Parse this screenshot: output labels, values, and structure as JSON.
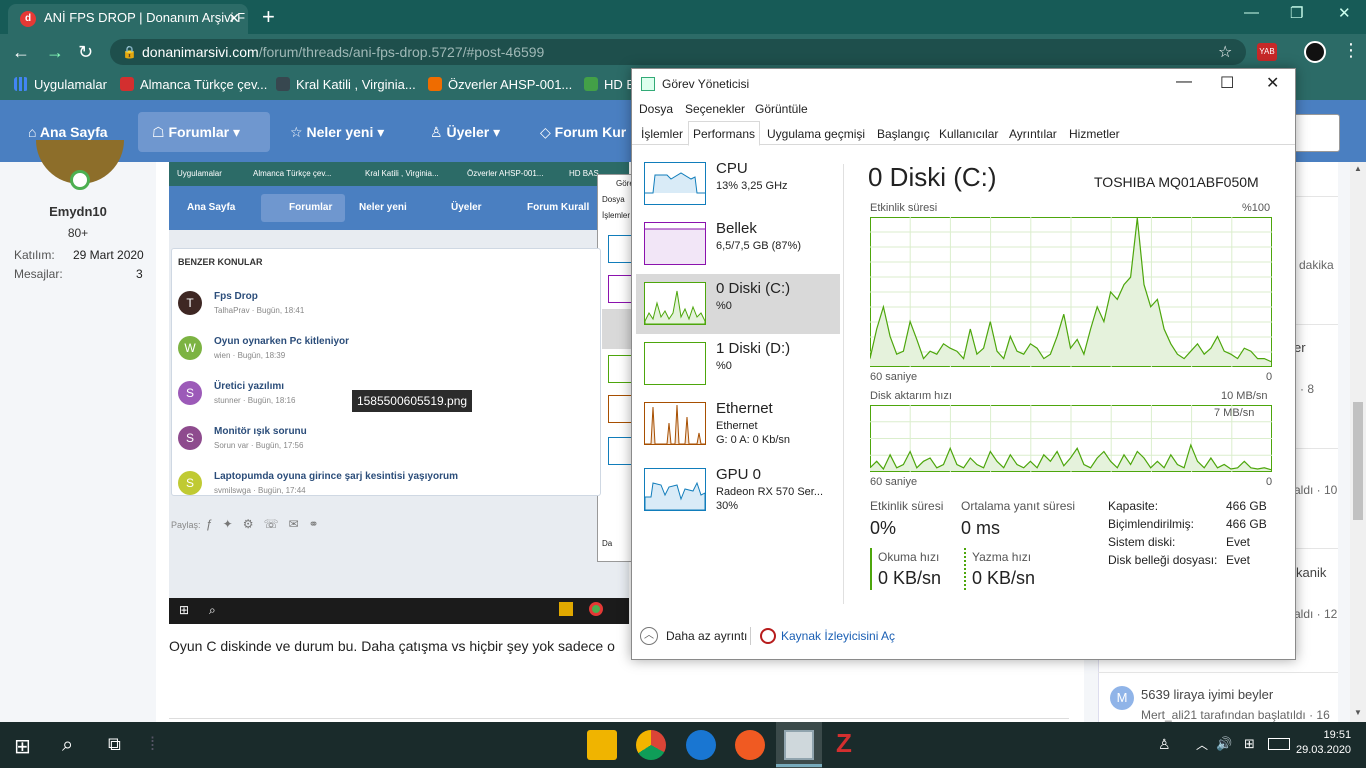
{
  "browser": {
    "tab_title": "ANİ FPS DROP | Donanım Arşivi F",
    "url_host": "donanimarsivi.com",
    "url_path": "/forum/threads/ani-fps-drop.5727/#post-46599",
    "ext_badge": "YAB",
    "bookmarks": [
      "Uygulamalar",
      "Almanca Türkçe çev...",
      "Kral Katili , Virginia...",
      "Özverler AHSP-001...",
      "HD B"
    ]
  },
  "site": {
    "nav": [
      "Ana Sayfa",
      "Forumlar",
      "Neler yeni",
      "Üyeler",
      "Forum Kur"
    ],
    "user": {
      "name": "Emydn10",
      "rank": "80+",
      "joined_label": "Katılım:",
      "joined_value": "29 Mart 2020",
      "messages_label": "Mesajlar:",
      "messages_value": "3"
    },
    "post_text": "Oyun C diskinde ve durum bu. Daha çatışma vs hiçbir şey yok sadece o",
    "right_fragments": [
      "dakika",
      "er",
      "· 8",
      "aldı · 10",
      "kanik",
      "aldı · 12"
    ],
    "right_thread": {
      "avatar_letter": "M",
      "title": "5639 liraya iyimi beyler",
      "meta": "Mert_ali21 tarafından başlatıldı · 16"
    }
  },
  "embedded": {
    "bookmarks": [
      "Uygulamalar",
      "Almanca Türkçe çev...",
      "Kral Katili , Virginia...",
      "Özverler AHSP-001...",
      "HD BAS"
    ],
    "nav": [
      "Ana Sayfa",
      "Forumlar",
      "Neler yeni",
      "Üyeler",
      "Forum Kurall"
    ],
    "tm_fragments": [
      "Göre",
      "Dosya",
      "İşlemler",
      "Da"
    ],
    "section_title": "BENZER KONULAR",
    "threads": [
      {
        "letter": "T",
        "title": "Fps Drop",
        "meta": "TalhaPrav · Bugün, 18:41",
        "color": "#3e2723"
      },
      {
        "letter": "W",
        "title": "Oyun oynarken Pc kitleniyor",
        "meta": "wien · Bugün, 18:39",
        "color": "#7cb342"
      },
      {
        "letter": "S",
        "title": "Üretici yazılımı",
        "meta": "stunner · Bugün, 18:16",
        "color": "#9c5ab8"
      },
      {
        "letter": "S",
        "title": "Monitör ışık sorunu",
        "meta": "Sorun var · Bugün, 17:56",
        "color": "#8e4b8e"
      },
      {
        "letter": "S",
        "title": "Laptopumda oyuna girince şarj kesintisi yaşıyorum",
        "meta": "svmilswga · Bugün, 17:44",
        "color": "#c0ca33"
      }
    ],
    "tooltip": "1585500605519.png",
    "share_label": "Paylaş:"
  },
  "taskmanager": {
    "title": "Görev Yöneticisi",
    "menu": [
      "Dosya",
      "Seçenekler",
      "Görüntüle"
    ],
    "tabs": [
      "İşlemler",
      "Performans",
      "Uygulama geçmişi",
      "Başlangıç",
      "Kullanıcılar",
      "Ayrıntılar",
      "Hizmetler"
    ],
    "active_tab": "Performans",
    "sidebar": [
      {
        "name": "CPU",
        "sub": "13%  3,25 GHz",
        "sub2": "",
        "color": "#117dbb"
      },
      {
        "name": "Bellek",
        "sub": "6,5/7,5 GB (87%)",
        "sub2": "",
        "color": "#8b12ae"
      },
      {
        "name": "0 Diski (C:)",
        "sub": "%0",
        "sub2": "",
        "color": "#4da60c"
      },
      {
        "name": "1 Diski (D:)",
        "sub": "%0",
        "sub2": "",
        "color": "#4da60c"
      },
      {
        "name": "Ethernet",
        "sub": "Ethernet",
        "sub2": "G: 0  A: 0 Kb/sn",
        "color": "#a74f01"
      },
      {
        "name": "GPU 0",
        "sub": "Radeon RX 570 Ser...",
        "sub2": "30%",
        "color": "#117dbb"
      }
    ],
    "disk": {
      "heading": "0 Diski (C:)",
      "model": "TOSHIBA MQ01ABF050M",
      "activity_label": "Etkinlik süresi",
      "activity_max": "%100",
      "activity_xleft": "60 saniye",
      "activity_xright": "0",
      "transfer_label": "Disk aktarım hızı",
      "transfer_max": "10 MB/sn",
      "transfer_mark": "7 MB/sn",
      "transfer_xleft": "60 saniye",
      "transfer_xright": "0",
      "stat_activity_label": "Etkinlik süresi",
      "stat_activity_value": "0%",
      "stat_response_label": "Ortalama yanıt süresi",
      "stat_response_value": "0 ms",
      "read_label": "Okuma hızı",
      "read_value": "0 KB/sn",
      "write_label": "Yazma hızı",
      "write_value": "0 KB/sn",
      "props": [
        {
          "k": "Kapasite:",
          "v": "466 GB"
        },
        {
          "k": "Biçimlendirilmiş:",
          "v": "466 GB"
        },
        {
          "k": "Sistem diski:",
          "v": "Evet"
        },
        {
          "k": "Disk belleği dosyası:",
          "v": "Evet"
        }
      ]
    },
    "footer_less": "Daha az ayrıntı",
    "footer_monitor": "Kaynak İzleyicisini Aç"
  },
  "chart_data": [
    {
      "type": "area",
      "title": "Etkinlik süresi",
      "ylim": [
        0,
        100
      ],
      "x": [
        60,
        59,
        58,
        57,
        56,
        55,
        54,
        53,
        52,
        51,
        50,
        49,
        48,
        47,
        46,
        45,
        44,
        43,
        42,
        41,
        40,
        39,
        38,
        37,
        36,
        35,
        34,
        33,
        32,
        31,
        30,
        29,
        28,
        27,
        26,
        25,
        24,
        23,
        22,
        21,
        20,
        19,
        18,
        17,
        16,
        15,
        14,
        13,
        12,
        11,
        10,
        9,
        8,
        7,
        6,
        5,
        4,
        3,
        2,
        1,
        0
      ],
      "values": [
        5,
        25,
        40,
        20,
        8,
        10,
        30,
        18,
        5,
        10,
        8,
        15,
        12,
        10,
        5,
        25,
        8,
        12,
        30,
        10,
        5,
        20,
        10,
        8,
        15,
        12,
        5,
        8,
        20,
        35,
        12,
        18,
        8,
        25,
        40,
        30,
        50,
        45,
        55,
        60,
        110,
        55,
        40,
        45,
        25,
        15,
        8,
        5,
        10,
        15,
        8,
        12,
        20,
        10,
        8,
        5,
        12,
        10,
        5,
        5,
        3
      ]
    },
    {
      "type": "area",
      "title": "Disk aktarım hızı",
      "ylim": [
        0,
        10
      ],
      "x": [
        60,
        59,
        58,
        57,
        56,
        55,
        54,
        53,
        52,
        51,
        50,
        49,
        48,
        47,
        46,
        45,
        44,
        43,
        42,
        41,
        40,
        39,
        38,
        37,
        36,
        35,
        34,
        33,
        32,
        31,
        30,
        29,
        28,
        27,
        26,
        25,
        24,
        23,
        22,
        21,
        20,
        19,
        18,
        17,
        16,
        15,
        14,
        13,
        12,
        11,
        10,
        9,
        8,
        7,
        6,
        5,
        4,
        3,
        2,
        1,
        0
      ],
      "values": [
        0.5,
        1.5,
        0.3,
        2.5,
        0.5,
        1.0,
        3.0,
        0.5,
        1.5,
        2.0,
        0.5,
        1.0,
        3.5,
        1.0,
        0.5,
        2.0,
        1.0,
        0.5,
        3.0,
        1.5,
        0.5,
        2.5,
        1.0,
        0.5,
        1.5,
        0.5,
        2.5,
        1.5,
        3.0,
        0.8,
        2.0,
        3.5,
        1.0,
        0.5,
        2.0,
        3.0,
        1.5,
        0.5,
        2.5,
        1.0,
        3.0,
        2.0,
        0.5,
        1.5,
        0.5,
        2.5,
        1.0,
        0.5,
        4.0,
        1.5,
        0.5,
        2.0,
        0.5,
        1.0,
        0.3,
        0.5,
        1.5,
        0.5,
        0.3,
        0.5,
        0.2
      ]
    }
  ],
  "taskbar": {
    "time": "19:51",
    "date": "29.03.2020"
  },
  "colors": {
    "chrome_bg": "#175b57",
    "site_nav": "#4a7fc1",
    "disk_green": "#4da60c",
    "taskbar": "#1a2b2b"
  }
}
